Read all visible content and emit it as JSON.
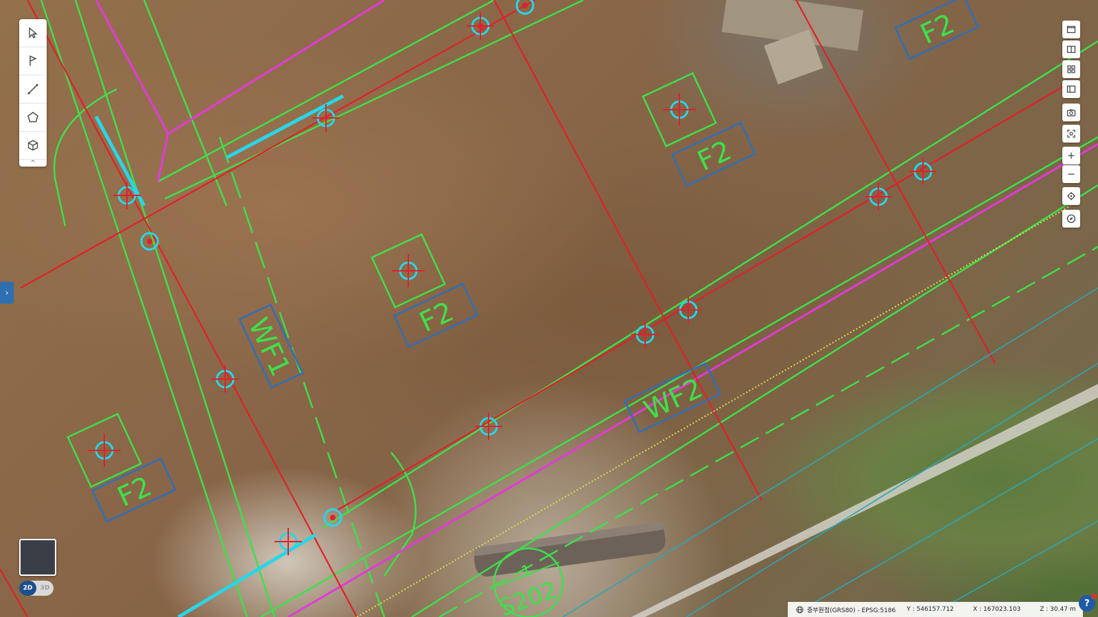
{
  "map": {
    "labels": {
      "f2_top_right": "F2",
      "f2_upper_middle": "F2",
      "f2_center": "F2",
      "f2_left_bottom": "F2",
      "wf1": "WF1",
      "wf2": "WF2",
      "s202": "S202",
      "s202_num": "1"
    },
    "colors": {
      "pipe_green": "#3ee04a",
      "pipe_magenta": "#e23ad8",
      "pipe_red": "#e0202a",
      "pipe_cyan": "#28d6e8",
      "box_blue": "#2f6fb8",
      "line_teal": "#2aa6b8"
    }
  },
  "left_toolbar": {
    "tools": [
      {
        "name": "select-tool",
        "icon": "cursor-icon"
      },
      {
        "name": "flag-tool",
        "icon": "flag-icon"
      },
      {
        "name": "line-tool",
        "icon": "line-icon"
      },
      {
        "name": "polygon-tool",
        "icon": "polygon-icon"
      },
      {
        "name": "cube-tool",
        "icon": "cube-icon"
      }
    ],
    "collapse_glyph": "^"
  },
  "right_toolbar": {
    "tools": [
      "single-view-icon",
      "split-view-icon",
      "grid-view-icon",
      "panel-view-icon",
      "camera-icon",
      "capture-icon",
      "zoom-in-icon",
      "zoom-out-icon",
      "locate-icon",
      "compass-icon"
    ]
  },
  "side_toggle": {
    "glyph": "›"
  },
  "view_mode": {
    "mode_2d": "2D",
    "mode_3d": "3D",
    "active": "2D"
  },
  "statusbar": {
    "crs": "중부원점(GRS80) - EPSG:5186",
    "y": "Y : 546157.712",
    "x": "X : 167023.103",
    "z": "Z : 30.47 m"
  },
  "help": {
    "glyph": "?"
  }
}
